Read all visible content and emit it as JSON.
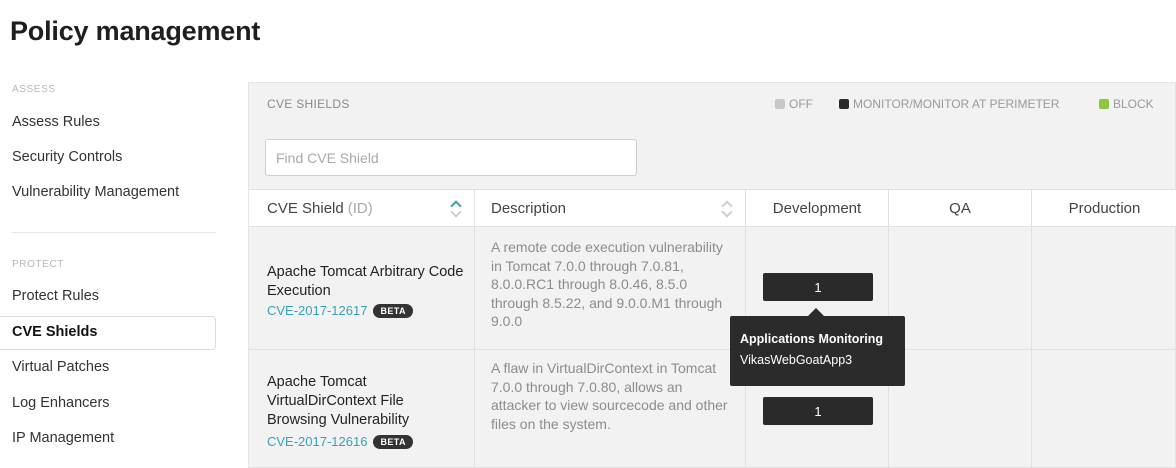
{
  "page": {
    "title": "Policy management"
  },
  "sidebar": {
    "assess_label": "ASSESS",
    "assess_items": [
      "Assess Rules",
      "Security Controls",
      "Vulnerability Management"
    ],
    "protect_label": "PROTECT",
    "protect_items": [
      "Protect Rules",
      "CVE Shields",
      "Virtual Patches",
      "Log Enhancers",
      "IP Management"
    ],
    "active_item": "CVE Shields"
  },
  "panel": {
    "title": "CVE SHIELDS",
    "legend": [
      {
        "label": "OFF",
        "color": "#c8c8c8"
      },
      {
        "label": "MONITOR/MONITOR AT PERIMETER",
        "color": "#2a2a2a"
      },
      {
        "label": "BLOCK",
        "color": "#8cc63f"
      }
    ],
    "search_placeholder": "Find CVE Shield"
  },
  "table": {
    "columns": {
      "shield": "CVE Shield",
      "shield_suffix": "(ID)",
      "description": "Description",
      "development": "Development",
      "qa": "QA",
      "production": "Production"
    },
    "sort_active_color": "#3aa7a0",
    "rows": [
      {
        "name": "Apache Tomcat Arbitrary Code Execution",
        "id": "CVE-2017-12617",
        "badge": "BETA",
        "description": "A remote code execution vulnerability in Tomcat 7.0.0 through 7.0.81, 8.0.0.RC1 through 8.0.46, 8.5.0 through 8.5.22, and 9.0.0.M1 through 9.0.0",
        "development": "1"
      },
      {
        "name": "Apache Tomcat VirtualDirContext File Browsing Vulnerability",
        "id": "CVE-2017-12616",
        "badge": "BETA",
        "description": "A flaw in VirtualDirContext in Tomcat 7.0.0 through 7.0.80, allows an attacker to view sourcecode and other files on the system.",
        "development": "1"
      }
    ]
  },
  "tooltip": {
    "title": "Applications Monitoring",
    "app": "VikasWebGoatApp3"
  }
}
